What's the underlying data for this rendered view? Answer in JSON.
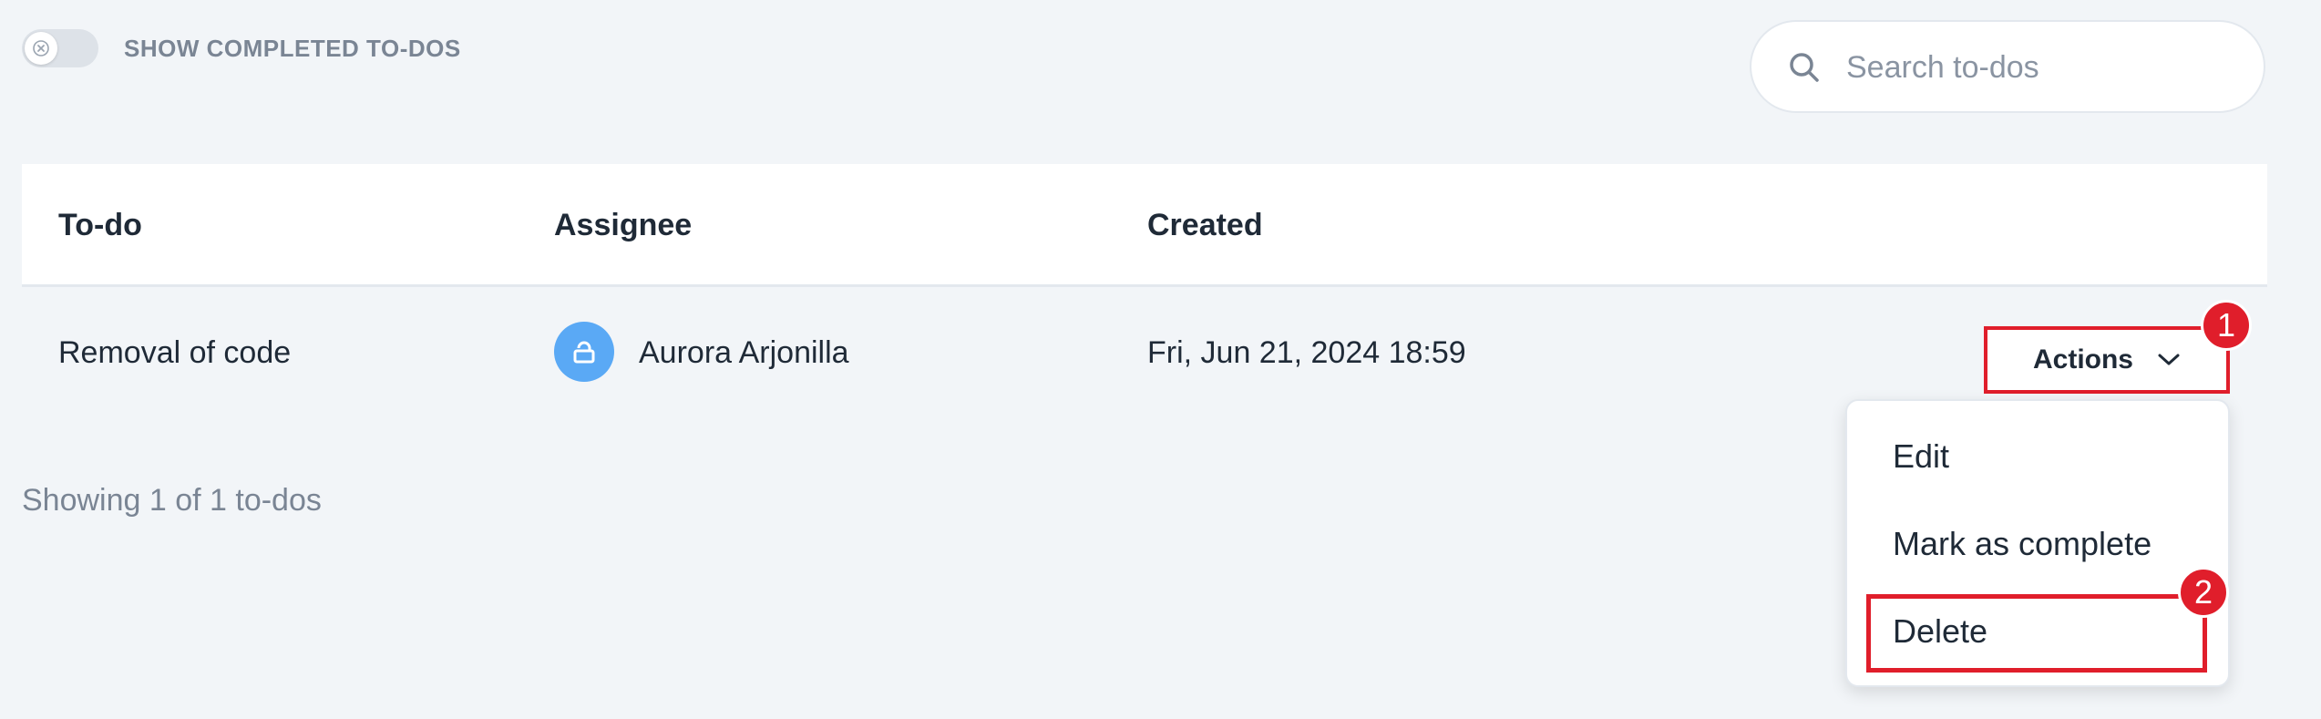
{
  "filters": {
    "show_completed_label": "SHOW COMPLETED TO-DOS",
    "search_placeholder": "Search to-dos"
  },
  "table": {
    "headers": [
      "To-do",
      "Assignee",
      "Created"
    ],
    "rows": [
      {
        "todo": "Removal of code",
        "assignee": "Aurora Arjonilla",
        "created": "Fri, Jun 21, 2024 18:59"
      }
    ]
  },
  "actions": {
    "button_label": "Actions",
    "menu_items": [
      "Edit",
      "Mark as complete",
      "Delete"
    ]
  },
  "footer": {
    "showing_text": "Showing 1 of 1 to-dos"
  },
  "annotations": {
    "badge_1": "1",
    "badge_2": "2"
  },
  "colors": {
    "background": "#f2f5f8",
    "highlight_red": "#e01e2b",
    "avatar_blue": "#5aa9f5"
  }
}
